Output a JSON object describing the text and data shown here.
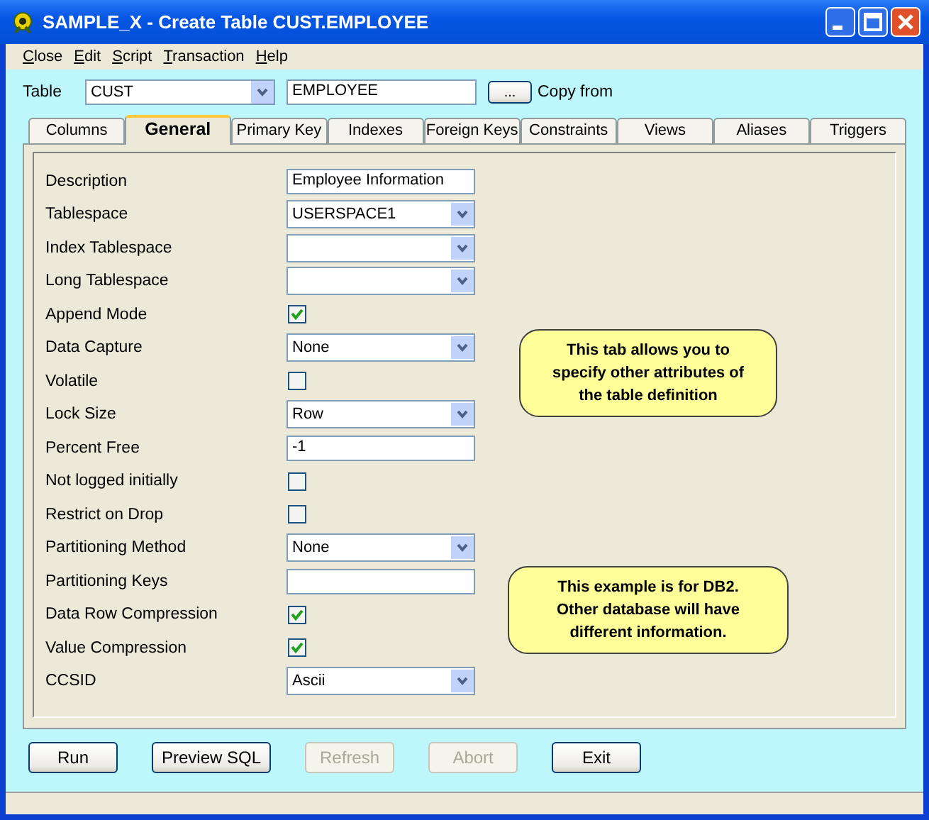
{
  "window": {
    "title": "SAMPLE_X - Create Table CUST.EMPLOYEE"
  },
  "menu": [
    "Close",
    "Edit",
    "Script",
    "Transaction",
    "Help"
  ],
  "table_row": {
    "label": "Table",
    "schema": "CUST",
    "name": "EMPLOYEE",
    "browse": "...",
    "copy_label": "Copy from"
  },
  "tabs": [
    {
      "label": "Columns",
      "selected": false
    },
    {
      "label": "General",
      "selected": true
    },
    {
      "label": "Primary Key",
      "selected": false
    },
    {
      "label": "Indexes",
      "selected": false
    },
    {
      "label": "Foreign Keys",
      "selected": false
    },
    {
      "label": "Constraints",
      "selected": false
    },
    {
      "label": "Views",
      "selected": false
    },
    {
      "label": "Aliases",
      "selected": false
    },
    {
      "label": "Triggers",
      "selected": false
    }
  ],
  "fields": [
    {
      "label": "Description",
      "kind": "text",
      "value": "Employee Information"
    },
    {
      "label": "Tablespace",
      "kind": "combo",
      "value": "USERSPACE1"
    },
    {
      "label": "Index Tablespace",
      "kind": "combo"
    },
    {
      "label": "Long Tablespace",
      "kind": "combo"
    },
    {
      "label": "Append Mode",
      "kind": "check",
      "checked": true
    },
    {
      "label": "Data Capture",
      "kind": "combo",
      "value": "None"
    },
    {
      "label": "Volatile",
      "kind": "check",
      "checked": false
    },
    {
      "label": "Lock Size",
      "kind": "combo",
      "value": "Row"
    },
    {
      "label": "Percent Free",
      "kind": "text",
      "value": "-1"
    },
    {
      "label": "Not logged initially",
      "kind": "check",
      "checked": false
    },
    {
      "label": "Restrict on Drop",
      "kind": "check",
      "checked": false
    },
    {
      "label": "Partitioning Method",
      "kind": "combo",
      "value": "None"
    },
    {
      "label": "Partitioning Keys",
      "kind": "text"
    },
    {
      "label": "Data Row Compression",
      "kind": "check",
      "checked": true
    },
    {
      "label": "Value Compression",
      "kind": "check",
      "checked": true
    },
    {
      "label": "CCSID",
      "kind": "combo",
      "value": "Ascii"
    }
  ],
  "callouts": [
    "This tab allows you to specify other attributes of the table definition",
    "This example is for DB2. Other database will have different information."
  ],
  "buttons": [
    {
      "label": "Run",
      "disabled": false
    },
    {
      "label": "Preview SQL",
      "disabled": false
    },
    {
      "label": "Refresh",
      "disabled": true
    },
    {
      "label": "Abort",
      "disabled": true
    },
    {
      "label": "Exit",
      "disabled": false
    }
  ]
}
